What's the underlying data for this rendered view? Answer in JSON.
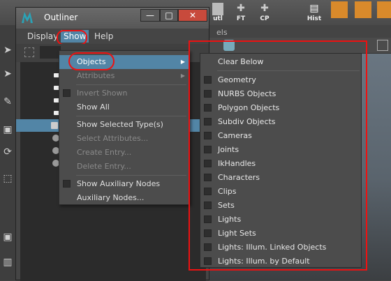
{
  "shelf": {
    "buttons": [
      {
        "label": "utl",
        "icon": "tool-icon"
      },
      {
        "label": "FT",
        "icon": "freeze-transform-icon"
      },
      {
        "label": "CP",
        "icon": "center-pivot-icon"
      },
      {
        "label": "Hist",
        "icon": "history-icon"
      }
    ]
  },
  "panel": {
    "label": "els"
  },
  "outliner": {
    "title": "Outliner",
    "window_buttons": {
      "minimize": "—",
      "maximize": "□",
      "close": "✕"
    },
    "menus": [
      {
        "label": "Display"
      },
      {
        "label": "Show"
      },
      {
        "label": "Help"
      }
    ]
  },
  "show_menu": {
    "items": [
      {
        "label": "Objects",
        "state": "highlighted",
        "submenu": true
      },
      {
        "label": "Attributes",
        "state": "disabled",
        "submenu": true
      },
      {
        "label": "Invert Shown",
        "state": "disabled",
        "checkbox": true
      },
      {
        "label": "Show All",
        "state": "enabled"
      },
      {
        "label": "Show Selected Type(s)",
        "state": "enabled"
      },
      {
        "label": "Select Attributes...",
        "state": "disabled"
      },
      {
        "label": "Create Entry...",
        "state": "disabled"
      },
      {
        "label": "Delete Entry...",
        "state": "disabled"
      },
      {
        "label": "Show Auxiliary Nodes",
        "state": "enabled",
        "checkbox": true
      },
      {
        "label": "Auxiliary Nodes...",
        "state": "enabled"
      }
    ]
  },
  "objects_submenu": {
    "clear_label": "Clear Below",
    "items": [
      {
        "label": "Geometry",
        "checked": false
      },
      {
        "label": "NURBS Objects",
        "checked": false
      },
      {
        "label": "Polygon Objects",
        "checked": false
      },
      {
        "label": "Subdiv Objects",
        "checked": false
      },
      {
        "label": "Cameras",
        "checked": false
      },
      {
        "label": "Joints",
        "checked": false
      },
      {
        "label": "IkHandles",
        "checked": false
      },
      {
        "label": "Characters",
        "checked": false
      },
      {
        "label": "Clips",
        "checked": false
      },
      {
        "label": "Sets",
        "checked": false
      },
      {
        "label": "Lights",
        "checked": false
      },
      {
        "label": "Light Sets",
        "checked": false
      },
      {
        "label": "Lights: Illum. Linked Objects",
        "checked": false
      },
      {
        "label": "Lights: Illum. by Default",
        "checked": false
      }
    ]
  },
  "colors": {
    "highlight": "#5285a6",
    "annotation_red": "#e11111",
    "menu_bg": "#4c4c4c"
  }
}
